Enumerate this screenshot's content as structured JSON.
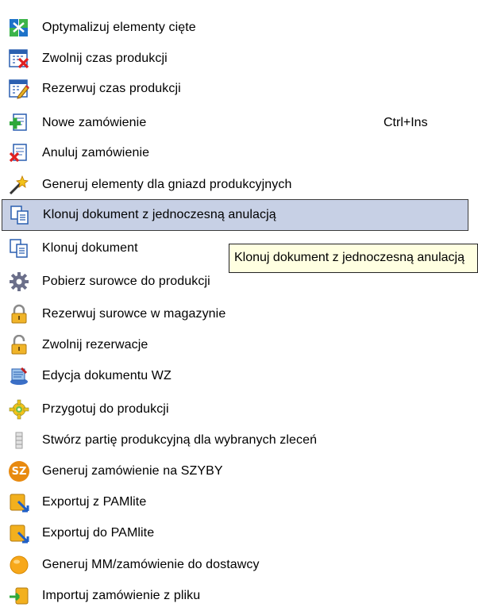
{
  "menu": {
    "items": [
      {
        "label": "Optymalizuj elementy cięte",
        "shortcut": "",
        "icon": "optimize-icon"
      },
      {
        "label": "Zwolnij czas produkcji",
        "shortcut": "",
        "icon": "release-time-icon"
      },
      {
        "label": "Rezerwuj czas produkcji",
        "shortcut": "",
        "icon": "reserve-time-icon"
      },
      {
        "label": "Nowe zamówienie",
        "shortcut": "Ctrl+Ins",
        "icon": "new-order-icon"
      },
      {
        "label": "Anuluj zamówienie",
        "shortcut": "",
        "icon": "cancel-order-icon"
      },
      {
        "label": "Generuj  elementy dla gniazd produkcyjnych",
        "shortcut": "",
        "icon": "magic-wand-icon"
      },
      {
        "label": "Klonuj dokument z jednoczesną anulacją",
        "shortcut": "",
        "icon": "clone-document-icon",
        "selected": true
      },
      {
        "label": "Klonuj dokument",
        "shortcut": "",
        "icon": "clone-document-icon"
      },
      {
        "label": "Pobierz surowce do produkcji",
        "shortcut": "",
        "icon": "gear-icon"
      },
      {
        "label": "Rezerwuj surowce w magazynie",
        "shortcut": "",
        "icon": "lock-icon"
      },
      {
        "label": "Zwolnij rezerwacje",
        "shortcut": "",
        "icon": "unlock-icon"
      },
      {
        "label": "Edycja dokumentu WZ",
        "shortcut": "",
        "icon": "edit-document-icon"
      },
      {
        "label": "Przygotuj do produkcji",
        "shortcut": "",
        "icon": "prepare-gear-icon"
      },
      {
        "label": "Stwórz partię produkcyjną dla wybranych zleceń",
        "shortcut": "",
        "icon": "batch-icon"
      },
      {
        "label": "Generuj zamówienie na SZYBY",
        "shortcut": "",
        "icon": "sz-badge-icon",
        "badge": "SZ"
      },
      {
        "label": "Exportuj z PAMlite",
        "shortcut": "",
        "icon": "export-icon"
      },
      {
        "label": "Exportuj do PAMlite",
        "shortcut": "",
        "icon": "export-icon"
      },
      {
        "label": "Generuj MM/zamówienie do dostawcy",
        "shortcut": "",
        "icon": "orange-circle-icon"
      },
      {
        "label": "Importuj zamówienie z pliku",
        "shortcut": "",
        "icon": "import-icon"
      }
    ]
  },
  "tooltip": {
    "text": "Klonuj dokument z jednoczesną anulacją"
  }
}
